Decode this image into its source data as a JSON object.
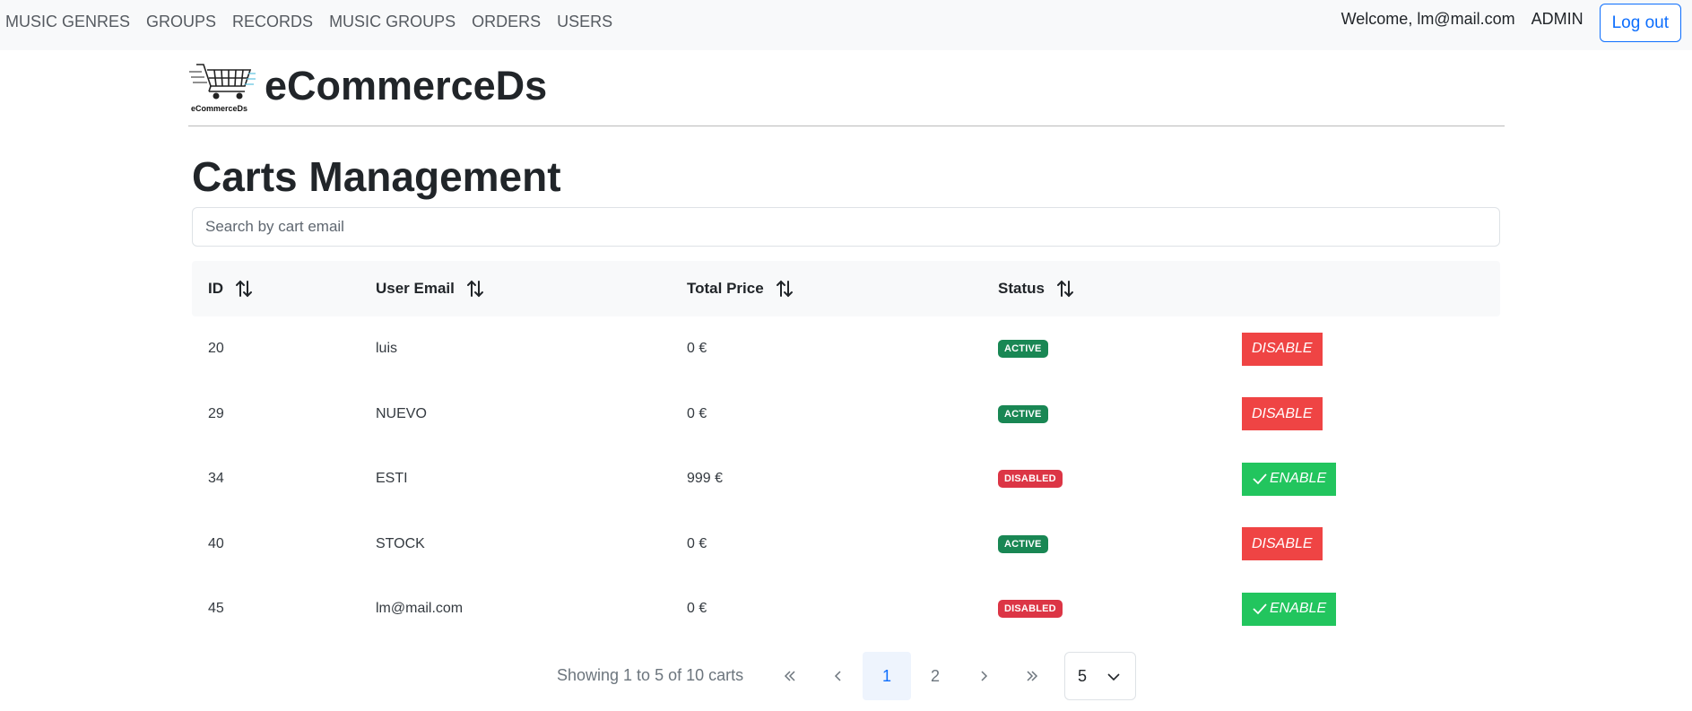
{
  "nav": {
    "links": [
      "MUSIC GENRES",
      "GROUPS",
      "RECORDS",
      "MUSIC GROUPS",
      "ORDERS",
      "USERS"
    ],
    "welcome": "Welcome, lm@mail.com",
    "role": "ADMIN",
    "logout_label": "Log out"
  },
  "brand": {
    "logo_text": "eCommerceDs",
    "name": "eCommerceDs"
  },
  "page": {
    "title": "Carts Management"
  },
  "search": {
    "placeholder": "Search by cart email"
  },
  "table": {
    "headers": {
      "id": "ID",
      "email": "User Email",
      "price": "Total Price",
      "status": "Status"
    },
    "rows": [
      {
        "id": "20",
        "email": "luis",
        "price": "0 €",
        "status": "ACTIVE",
        "action": "DISABLE"
      },
      {
        "id": "29",
        "email": "NUEVO",
        "price": "0 €",
        "status": "ACTIVE",
        "action": "DISABLE"
      },
      {
        "id": "34",
        "email": "ESTI",
        "price": "999 €",
        "status": "DISABLED",
        "action": "ENABLE"
      },
      {
        "id": "40",
        "email": "STOCK",
        "price": "0 €",
        "status": "ACTIVE",
        "action": "DISABLE"
      },
      {
        "id": "45",
        "email": "lm@mail.com",
        "price": "0 €",
        "status": "DISABLED",
        "action": "ENABLE"
      }
    ]
  },
  "pagination": {
    "summary": "Showing 1 to 5 of 10 carts",
    "pages": [
      "1",
      "2"
    ],
    "current_page": "1",
    "page_size": "5"
  },
  "colors": {
    "active_badge": "#198754",
    "disabled_badge": "#dc3545",
    "disable_button": "#ef4444",
    "enable_button": "#22c55e",
    "primary": "#0d6efd"
  },
  "icons": {
    "sort": "sort-arrows-icon",
    "check": "check-icon",
    "first": "double-chevron-left-icon",
    "prev": "chevron-left-icon",
    "next": "chevron-right-icon",
    "last": "double-chevron-right-icon",
    "dropdown": "chevron-down-icon"
  }
}
